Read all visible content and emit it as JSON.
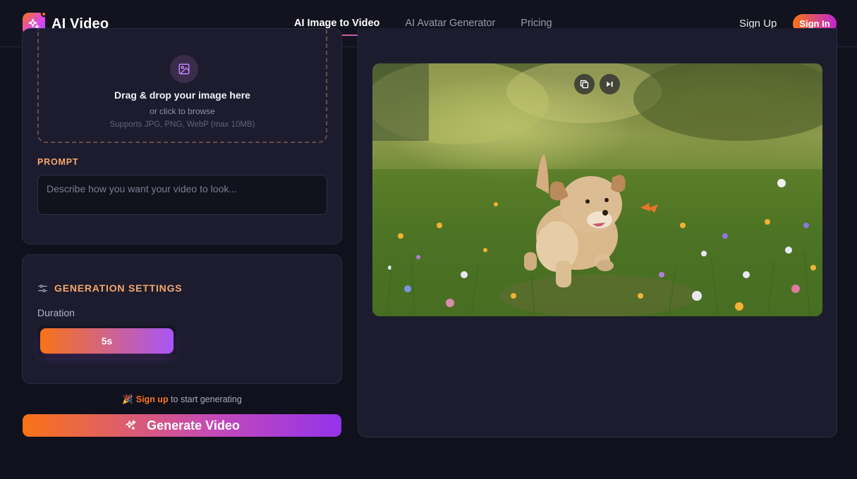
{
  "app": {
    "name": "AI Video"
  },
  "nav": {
    "items": [
      {
        "label": "AI Image to Video",
        "active": true
      },
      {
        "label": "AI Avatar Generator",
        "active": false
      },
      {
        "label": "Pricing",
        "active": false
      }
    ]
  },
  "auth": {
    "signup_label": "Sign Up",
    "signin_label": "Sign In"
  },
  "upload": {
    "icon": "image-icon",
    "title": "Drag & drop your image here",
    "subtitle": "or click to browse",
    "hint": "Supports JPG, PNG, WebP (max 10MB)"
  },
  "prompt": {
    "label": "PROMPT",
    "placeholder": "Describe how you want your video to look...",
    "value": ""
  },
  "settings": {
    "icon": "sliders-icon",
    "title": "GENERATION SETTINGS",
    "duration_label": "Duration",
    "duration_value": "5s"
  },
  "cta": {
    "hint_emoji": "🎉",
    "hint_link": "Sign up",
    "hint_text": " to start generating",
    "generate_label": "Generate Video"
  },
  "preview": {
    "controls": [
      "copy-icon",
      "skip-forward-icon"
    ]
  },
  "colors": {
    "accent_orange": "#f97316",
    "accent_purple": "#a855f7",
    "background": "#11111d",
    "card": "#1c1c2e"
  }
}
